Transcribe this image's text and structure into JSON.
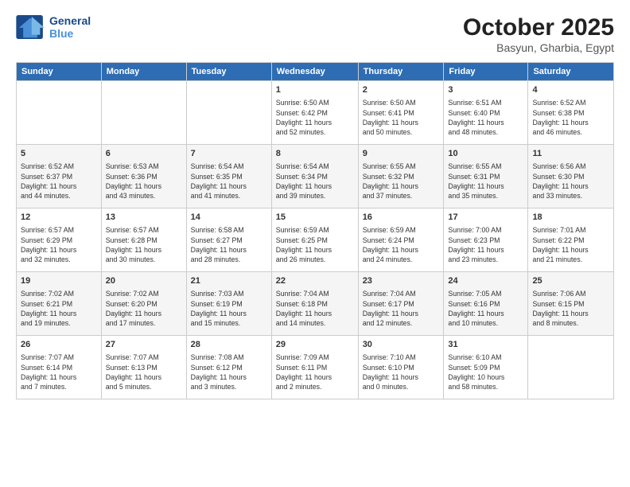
{
  "header": {
    "logo_line1": "General",
    "logo_line2": "Blue",
    "month": "October 2025",
    "location": "Basyun, Gharbia, Egypt"
  },
  "weekdays": [
    "Sunday",
    "Monday",
    "Tuesday",
    "Wednesday",
    "Thursday",
    "Friday",
    "Saturday"
  ],
  "weeks": [
    [
      {
        "day": "",
        "info": ""
      },
      {
        "day": "",
        "info": ""
      },
      {
        "day": "",
        "info": ""
      },
      {
        "day": "1",
        "info": "Sunrise: 6:50 AM\nSunset: 6:42 PM\nDaylight: 11 hours\nand 52 minutes."
      },
      {
        "day": "2",
        "info": "Sunrise: 6:50 AM\nSunset: 6:41 PM\nDaylight: 11 hours\nand 50 minutes."
      },
      {
        "day": "3",
        "info": "Sunrise: 6:51 AM\nSunset: 6:40 PM\nDaylight: 11 hours\nand 48 minutes."
      },
      {
        "day": "4",
        "info": "Sunrise: 6:52 AM\nSunset: 6:38 PM\nDaylight: 11 hours\nand 46 minutes."
      }
    ],
    [
      {
        "day": "5",
        "info": "Sunrise: 6:52 AM\nSunset: 6:37 PM\nDaylight: 11 hours\nand 44 minutes."
      },
      {
        "day": "6",
        "info": "Sunrise: 6:53 AM\nSunset: 6:36 PM\nDaylight: 11 hours\nand 43 minutes."
      },
      {
        "day": "7",
        "info": "Sunrise: 6:54 AM\nSunset: 6:35 PM\nDaylight: 11 hours\nand 41 minutes."
      },
      {
        "day": "8",
        "info": "Sunrise: 6:54 AM\nSunset: 6:34 PM\nDaylight: 11 hours\nand 39 minutes."
      },
      {
        "day": "9",
        "info": "Sunrise: 6:55 AM\nSunset: 6:32 PM\nDaylight: 11 hours\nand 37 minutes."
      },
      {
        "day": "10",
        "info": "Sunrise: 6:55 AM\nSunset: 6:31 PM\nDaylight: 11 hours\nand 35 minutes."
      },
      {
        "day": "11",
        "info": "Sunrise: 6:56 AM\nSunset: 6:30 PM\nDaylight: 11 hours\nand 33 minutes."
      }
    ],
    [
      {
        "day": "12",
        "info": "Sunrise: 6:57 AM\nSunset: 6:29 PM\nDaylight: 11 hours\nand 32 minutes."
      },
      {
        "day": "13",
        "info": "Sunrise: 6:57 AM\nSunset: 6:28 PM\nDaylight: 11 hours\nand 30 minutes."
      },
      {
        "day": "14",
        "info": "Sunrise: 6:58 AM\nSunset: 6:27 PM\nDaylight: 11 hours\nand 28 minutes."
      },
      {
        "day": "15",
        "info": "Sunrise: 6:59 AM\nSunset: 6:25 PM\nDaylight: 11 hours\nand 26 minutes."
      },
      {
        "day": "16",
        "info": "Sunrise: 6:59 AM\nSunset: 6:24 PM\nDaylight: 11 hours\nand 24 minutes."
      },
      {
        "day": "17",
        "info": "Sunrise: 7:00 AM\nSunset: 6:23 PM\nDaylight: 11 hours\nand 23 minutes."
      },
      {
        "day": "18",
        "info": "Sunrise: 7:01 AM\nSunset: 6:22 PM\nDaylight: 11 hours\nand 21 minutes."
      }
    ],
    [
      {
        "day": "19",
        "info": "Sunrise: 7:02 AM\nSunset: 6:21 PM\nDaylight: 11 hours\nand 19 minutes."
      },
      {
        "day": "20",
        "info": "Sunrise: 7:02 AM\nSunset: 6:20 PM\nDaylight: 11 hours\nand 17 minutes."
      },
      {
        "day": "21",
        "info": "Sunrise: 7:03 AM\nSunset: 6:19 PM\nDaylight: 11 hours\nand 15 minutes."
      },
      {
        "day": "22",
        "info": "Sunrise: 7:04 AM\nSunset: 6:18 PM\nDaylight: 11 hours\nand 14 minutes."
      },
      {
        "day": "23",
        "info": "Sunrise: 7:04 AM\nSunset: 6:17 PM\nDaylight: 11 hours\nand 12 minutes."
      },
      {
        "day": "24",
        "info": "Sunrise: 7:05 AM\nSunset: 6:16 PM\nDaylight: 11 hours\nand 10 minutes."
      },
      {
        "day": "25",
        "info": "Sunrise: 7:06 AM\nSunset: 6:15 PM\nDaylight: 11 hours\nand 8 minutes."
      }
    ],
    [
      {
        "day": "26",
        "info": "Sunrise: 7:07 AM\nSunset: 6:14 PM\nDaylight: 11 hours\nand 7 minutes."
      },
      {
        "day": "27",
        "info": "Sunrise: 7:07 AM\nSunset: 6:13 PM\nDaylight: 11 hours\nand 5 minutes."
      },
      {
        "day": "28",
        "info": "Sunrise: 7:08 AM\nSunset: 6:12 PM\nDaylight: 11 hours\nand 3 minutes."
      },
      {
        "day": "29",
        "info": "Sunrise: 7:09 AM\nSunset: 6:11 PM\nDaylight: 11 hours\nand 2 minutes."
      },
      {
        "day": "30",
        "info": "Sunrise: 7:10 AM\nSunset: 6:10 PM\nDaylight: 11 hours\nand 0 minutes."
      },
      {
        "day": "31",
        "info": "Sunrise: 6:10 AM\nSunset: 5:09 PM\nDaylight: 10 hours\nand 58 minutes."
      },
      {
        "day": "",
        "info": ""
      }
    ]
  ]
}
